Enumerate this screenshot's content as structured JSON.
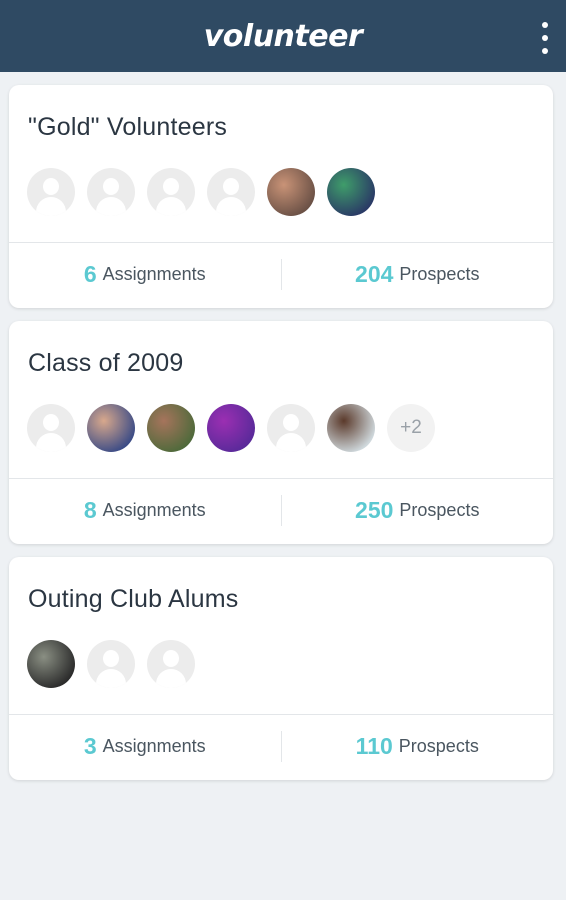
{
  "app": {
    "logo": "volunteer",
    "menu_icon": "more-vert-icon"
  },
  "groups": [
    {
      "name": "\"Gold\" Volunteers",
      "avatars": [
        {
          "type": "placeholder"
        },
        {
          "type": "placeholder"
        },
        {
          "type": "placeholder"
        },
        {
          "type": "placeholder"
        },
        {
          "type": "photo",
          "colors": [
            "#6b5146",
            "#c99377"
          ]
        },
        {
          "type": "photo",
          "colors": [
            "#2a3a66",
            "#3f9d6a"
          ]
        }
      ],
      "assignments_count": "6",
      "assignments_label": "Assignments",
      "prospects_count": "204",
      "prospects_label": "Prospects"
    },
    {
      "name": "Class of 2009",
      "avatars": [
        {
          "type": "placeholder"
        },
        {
          "type": "photo",
          "colors": [
            "#3c4c86",
            "#d8a88c"
          ]
        },
        {
          "type": "photo",
          "colors": [
            "#4f6a3b",
            "#a6745c"
          ]
        },
        {
          "type": "photo",
          "colors": [
            "#5a2a9a",
            "#9b2fb2"
          ]
        },
        {
          "type": "placeholder"
        },
        {
          "type": "photo",
          "colors": [
            "#cfd8dc",
            "#5b3a2b"
          ]
        },
        {
          "type": "more",
          "label": "+2"
        }
      ],
      "assignments_count": "8",
      "assignments_label": "Assignments",
      "prospects_count": "250",
      "prospects_label": "Prospects"
    },
    {
      "name": "Outing Club Alums",
      "avatars": [
        {
          "type": "photo",
          "colors": [
            "#2b2b2b",
            "#8a8f83"
          ]
        },
        {
          "type": "placeholder"
        },
        {
          "type": "placeholder"
        }
      ],
      "assignments_count": "3",
      "assignments_label": "Assignments",
      "prospects_count": "110",
      "prospects_label": "Prospects"
    }
  ]
}
